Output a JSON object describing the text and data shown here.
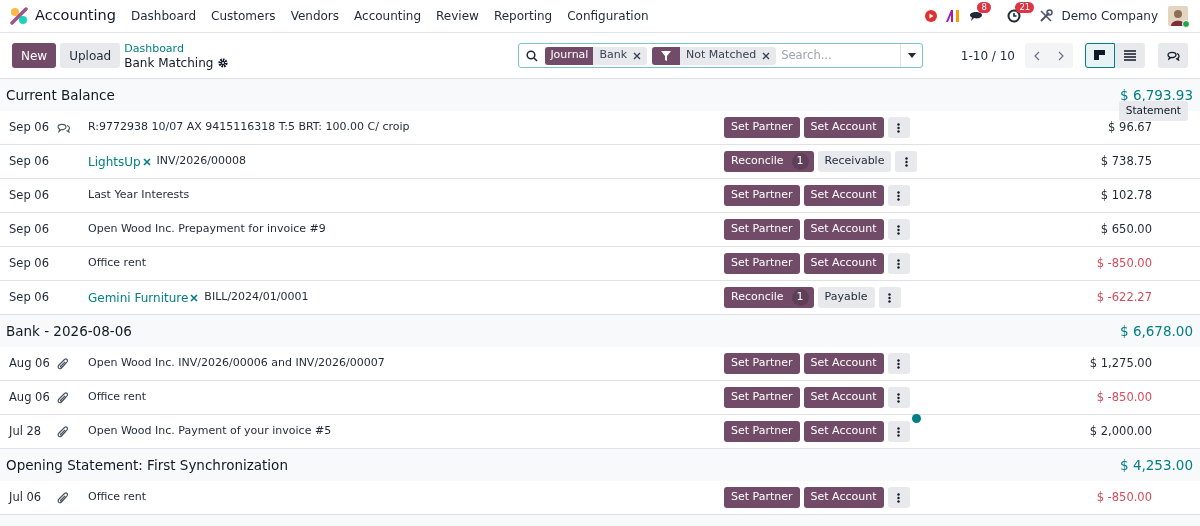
{
  "app": {
    "name": "Accounting"
  },
  "menu": [
    "Dashboard",
    "Customers",
    "Vendors",
    "Accounting",
    "Review",
    "Reporting",
    "Configuration"
  ],
  "systray": {
    "messages_count": "8",
    "activities_count": "21",
    "company": "Demo Company"
  },
  "control_panel": {
    "buttons": [
      {
        "kind": "primary",
        "label": "New"
      },
      {
        "kind": "secondary",
        "label": "Upload"
      }
    ],
    "breadcrumb": "Dashboard",
    "title": "Bank Matching",
    "search": {
      "facets": [
        {
          "kind": "field",
          "label": "Journal",
          "value": "Bank"
        },
        {
          "kind": "filter",
          "value": "Not Matched"
        }
      ],
      "placeholder": "Search..."
    },
    "pager": "1-10 / 10",
    "views": [
      {
        "kind": "kanban",
        "selected": true
      },
      {
        "kind": "list",
        "selected": false
      }
    ]
  },
  "groups": [
    {
      "title": "Current Balance",
      "amount": "$ 6,793.93",
      "tooltip": "Statement",
      "rows": [
        {
          "date": "Sep 06",
          "kind": "note",
          "label": "R:9772938 10/07 AX 9415116318 T:5 BRT: 100.00 C/ croip",
          "actions": [
            {
              "kind": "primary",
              "label": "Set Partner"
            },
            {
              "kind": "primary",
              "label": "Set Account"
            }
          ],
          "amount": "$ 96.67",
          "negative": false,
          "dot": false
        },
        {
          "date": "Sep 06",
          "kind": "plain",
          "partner": "LightsUp",
          "label": "INV/2026/00008",
          "actions": [
            {
              "kind": "primary",
              "label": "Reconcile",
              "count": "1"
            },
            {
              "kind": "secondary",
              "label": "Receivable"
            }
          ],
          "amount": "$ 738.75",
          "negative": false,
          "dot": false
        },
        {
          "date": "Sep 06",
          "kind": "plain",
          "label": "Last Year Interests",
          "actions": [
            {
              "kind": "primary",
              "label": "Set Partner"
            },
            {
              "kind": "primary",
              "label": "Set Account"
            }
          ],
          "amount": "$ 102.78",
          "negative": false,
          "dot": false
        },
        {
          "date": "Sep 06",
          "kind": "plain",
          "label": "Open Wood Inc. Prepayment for invoice #9",
          "actions": [
            {
              "kind": "primary",
              "label": "Set Partner"
            },
            {
              "kind": "primary",
              "label": "Set Account"
            }
          ],
          "amount": "$ 650.00",
          "negative": false,
          "dot": false
        },
        {
          "date": "Sep 06",
          "kind": "plain",
          "label": "Office rent",
          "actions": [
            {
              "kind": "primary",
              "label": "Set Partner"
            },
            {
              "kind": "primary",
              "label": "Set Account"
            }
          ],
          "amount": "$ -850.00",
          "negative": true,
          "dot": false
        },
        {
          "date": "Sep 06",
          "kind": "plain",
          "partner": "Gemini Furniture",
          "label": "BILL/2024/01/0001",
          "actions": [
            {
              "kind": "primary",
              "label": "Reconcile",
              "count": "1"
            },
            {
              "kind": "secondary",
              "label": "Payable"
            }
          ],
          "amount": "$ -622.27",
          "negative": true,
          "dot": false
        }
      ]
    },
    {
      "title": "Bank - 2026-08-06",
      "amount": "$ 6,678.00",
      "rows": [
        {
          "date": "Aug 06",
          "kind": "attachment",
          "label": "Open Wood Inc. INV/2026/00006 and INV/2026/00007",
          "actions": [
            {
              "kind": "primary",
              "label": "Set Partner"
            },
            {
              "kind": "primary",
              "label": "Set Account"
            }
          ],
          "amount": "$ 1,275.00",
          "negative": false,
          "dot": false
        },
        {
          "date": "Aug 06",
          "kind": "attachment",
          "label": "Office rent",
          "actions": [
            {
              "kind": "primary",
              "label": "Set Partner"
            },
            {
              "kind": "primary",
              "label": "Set Account"
            }
          ],
          "amount": "$ -850.00",
          "negative": true,
          "dot": false
        },
        {
          "date": "Jul 28",
          "kind": "attachment",
          "label": "Open Wood Inc. Payment of your invoice #5",
          "actions": [
            {
              "kind": "primary",
              "label": "Set Partner"
            },
            {
              "kind": "primary",
              "label": "Set Account"
            }
          ],
          "amount": "$ 2,000.00",
          "negative": false,
          "dot": true
        }
      ]
    },
    {
      "title": "Opening Statement: First Synchronization",
      "amount": "$ 4,253.00",
      "rows": [
        {
          "date": "Jul 06",
          "kind": "attachment",
          "label": "Office rent",
          "actions": [
            {
              "kind": "primary",
              "label": "Set Partner"
            },
            {
              "kind": "primary",
              "label": "Set Account"
            }
          ],
          "amount": "$ -850.00",
          "negative": true,
          "dot": false
        }
      ]
    }
  ]
}
